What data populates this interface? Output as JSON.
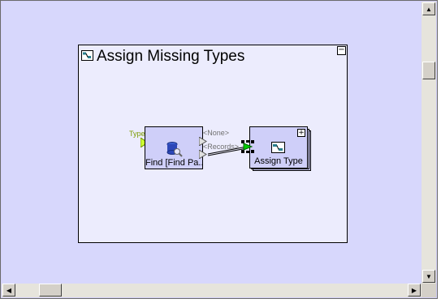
{
  "group": {
    "title": "Assign Missing Types",
    "collapse_symbol": "−"
  },
  "find_node": {
    "label": "Find [Find Pa...",
    "input_port": "Type",
    "output_port_none": "<None>",
    "output_port_records": "<Records>"
  },
  "assign_node": {
    "label": "Assign Type",
    "expand_symbol": "+"
  },
  "scrollbars": {
    "up_arrow": "▲",
    "down_arrow": "▼",
    "left_arrow": "◀",
    "right_arrow": "▶"
  },
  "colors": {
    "canvas": "#d7d7fc",
    "group_fill": "#ececfd",
    "node_fill": "#cfcff9",
    "port_input": "#ccff33",
    "connector_green": "#00cc00"
  }
}
